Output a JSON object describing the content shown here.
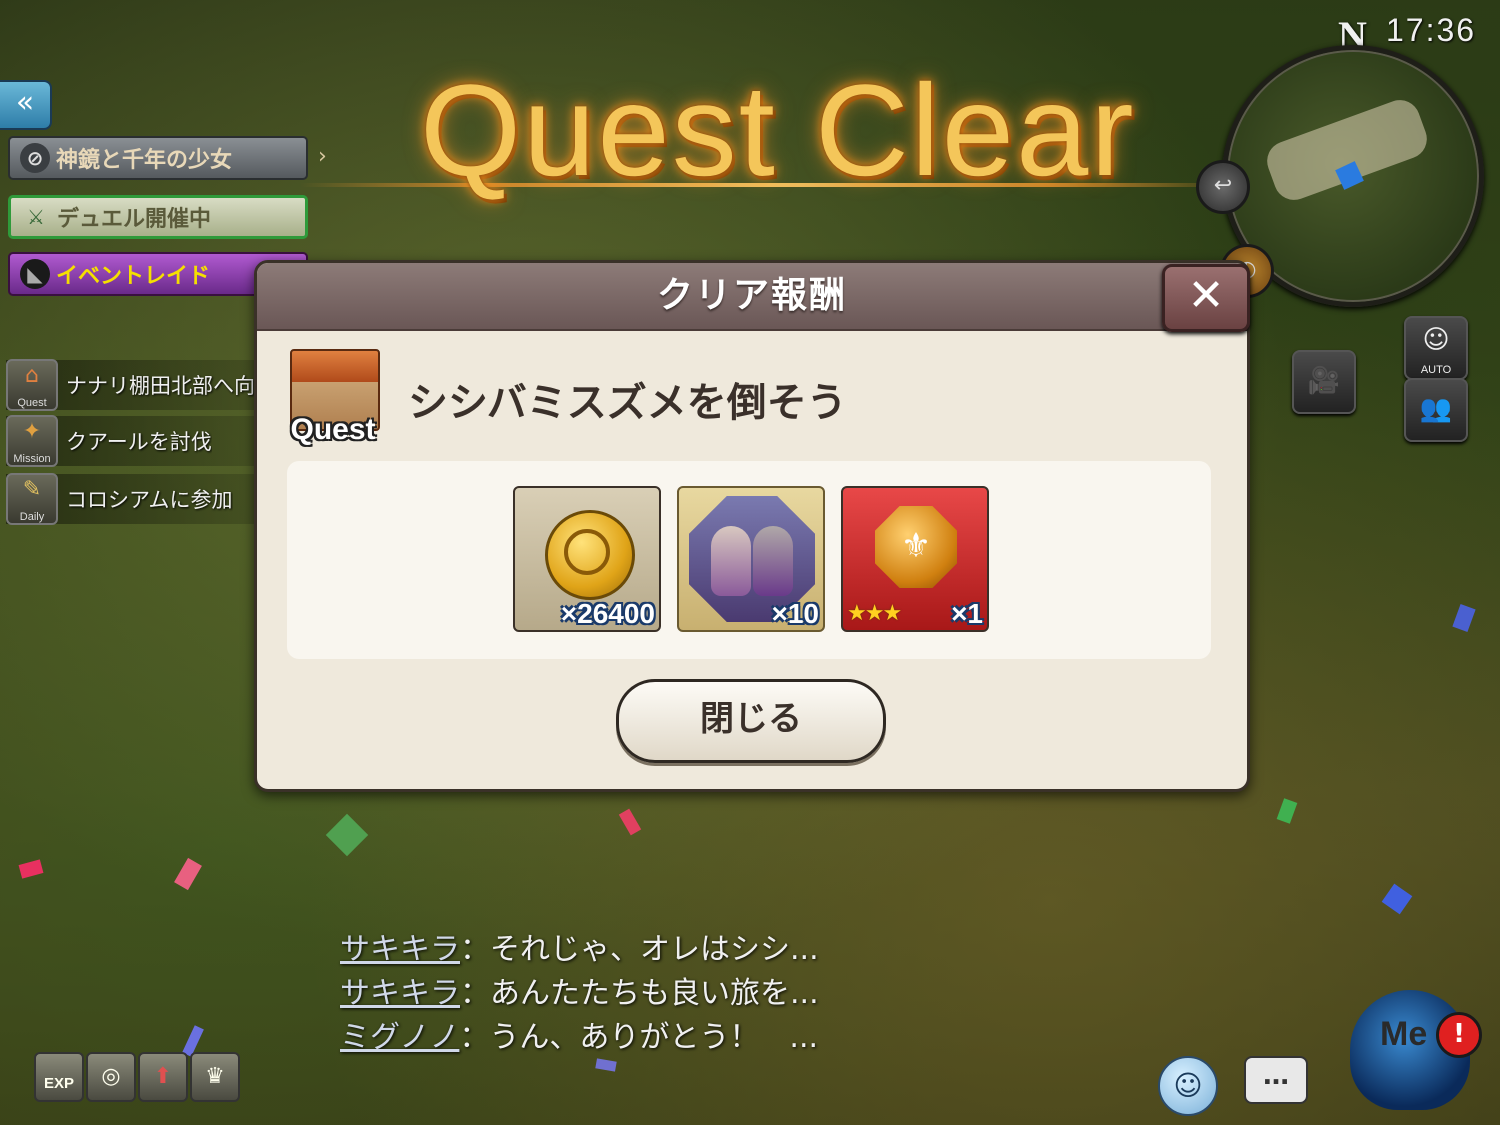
{
  "header": {
    "title": "Quest Clear",
    "time": "17:36",
    "compass_label": "N"
  },
  "left_panel": {
    "back_label": "«",
    "story_banner": "神鏡と千年の少女",
    "duel_banner": "デュエル開催中",
    "raid_banner": "イベントレイド",
    "missions": [
      {
        "tag": "Quest",
        "text": "ナナリ棚田北部へ向"
      },
      {
        "tag": "Mission",
        "text": "クアールを討伐"
      },
      {
        "tag": "Daily",
        "text": "コロシアムに参加"
      }
    ]
  },
  "right_controls": {
    "auto_label": "AUTO"
  },
  "dialog": {
    "title": "クリア報酬",
    "close_symbol": "✕",
    "quest_icon_label": "Quest",
    "quest_name": "シシバミスズメを倒そう",
    "rewards": [
      {
        "icon": "gold-coin-icon",
        "quantity": "×26400"
      },
      {
        "icon": "bunny-characters-icon",
        "quantity": "×10"
      },
      {
        "icon": "medal-icon",
        "stars": "★★★",
        "quantity": "×1"
      }
    ],
    "close_button": "閉じる"
  },
  "chat": [
    {
      "speaker": "サキキラ",
      "text": "：それじゃ、オレはシシ..."
    },
    {
      "speaker": "サキキラ",
      "text": "：あんたたちも良い旅を..."
    },
    {
      "speaker": "ミグノノ",
      "text": "：うん、ありがとう！　..."
    }
  ],
  "bottom_bar": {
    "exp_label": "EXP",
    "mascot_label": "Me",
    "alert_symbol": "!"
  },
  "colors": {
    "title_gold": "#f4c65a",
    "dialog_bg": "#efe9dc",
    "header_bg": "#7a6866",
    "raid_purple": "#8a3aaa",
    "duel_green": "#2f9a3a",
    "medal_red": "#d03030"
  }
}
